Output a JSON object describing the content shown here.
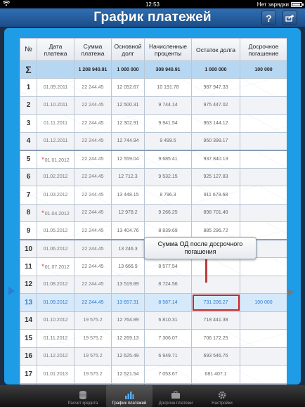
{
  "status": {
    "time": "12:53",
    "charge": "Нет зарядки"
  },
  "nav": {
    "title": "График платежей",
    "help_label": "?",
    "share_icon": "share-icon"
  },
  "table": {
    "headers": [
      "№",
      "Дата\nплатежа",
      "Сумма\nплатежа",
      "Основной\nдолг",
      "Начисленные\nпроценты",
      "Остаток долга",
      "Досрочное\nпогашение"
    ],
    "sum": {
      "symbol": "Σ",
      "payment": "1 208 940.91",
      "principal": "1 000 000",
      "interest": "308 940.91",
      "balance": "1 000 000",
      "early": "100 000"
    },
    "rows": [
      {
        "n": "1",
        "date": "01.09.2011",
        "pay": "22 244.45",
        "od": "12 052.67",
        "pct": "10 191.78",
        "bal": "987 947.33",
        "mark": false
      },
      {
        "n": "2",
        "date": "01.10.2011",
        "pay": "22 244.45",
        "od": "12 500.31",
        "pct": "9 744.14",
        "bal": "975 447.02",
        "mark": false
      },
      {
        "n": "3",
        "date": "01.11.2011",
        "pay": "22 244.45",
        "od": "12 302.91",
        "pct": "9 941.54",
        "bal": "963 144.12",
        "mark": false
      },
      {
        "n": "4",
        "date": "01.12.2011",
        "pay": "22 244.45",
        "od": "12 744.94",
        "pct": "9 499.5",
        "bal": "950 399.17",
        "mark": false
      },
      {
        "n": "5",
        "date": "01.01.2012",
        "pay": "22 244.45",
        "od": "12 559.04",
        "pct": "9 685.41",
        "bal": "937 840.13",
        "mark": true
      },
      {
        "n": "6",
        "date": "01.02.2012",
        "pay": "22 244.45",
        "od": "12 712.3",
        "pct": "9 532.15",
        "bal": "925 127.83",
        "mark": false
      },
      {
        "n": "7",
        "date": "01.03.2012",
        "pay": "22 244.45",
        "od": "13 448.15",
        "pct": "8 796.3",
        "bal": "911 679.68",
        "mark": false
      },
      {
        "n": "8",
        "date": "01.04.2012",
        "pay": "22 244.45",
        "od": "12 978.2",
        "pct": "9 266.25",
        "bal": "898 701.48",
        "mark": true
      },
      {
        "n": "9",
        "date": "01.05.2012",
        "pay": "22 244.45",
        "od": "13 404.76",
        "pct": "8 839.69",
        "bal": "885 296.72",
        "mark": false
      },
      {
        "n": "10",
        "date": "01.06.2012",
        "pay": "22 244.45",
        "od": "13 246.3",
        "pct": "",
        "bal": "",
        "mark": false
      },
      {
        "n": "11",
        "date": "01.07.2012",
        "pay": "22 244.45",
        "od": "13 666.9",
        "pct": "8 577.54",
        "bal": "",
        "mark": true
      },
      {
        "n": "12",
        "date": "01.08.2012",
        "pay": "22 244.45",
        "od": "13 519.89",
        "pct": "8 724.56",
        "bal": "",
        "mark": false
      },
      {
        "n": "13",
        "date": "01.09.2012",
        "pay": "22 244.45",
        "od": "13 657.31",
        "pct": "8 587.14",
        "bal": "731 206.27",
        "early": "100 000",
        "mark": false,
        "highlight": true
      },
      {
        "n": "14",
        "date": "01.10.2012",
        "pay": "19 575.2",
        "od": "12 764.89",
        "pct": "6 810.31",
        "bal": "718 441.38",
        "mark": false
      },
      {
        "n": "15",
        "date": "01.11.2012",
        "pay": "19 575.2",
        "od": "12 269.13",
        "pct": "7 306.07",
        "bal": "706 172.25",
        "mark": false
      },
      {
        "n": "16",
        "date": "01.12.2012",
        "pay": "19 575.2",
        "od": "12 625.49",
        "pct": "6 949.71",
        "bal": "693 546.76",
        "mark": false
      },
      {
        "n": "17",
        "date": "01.01.2013",
        "pay": "19 575.2",
        "od": "12 521.54",
        "pct": "7 053.67",
        "bal": "681 407.1",
        "mark": false
      },
      {
        "n": "18",
        "date": "01.02.2013",
        "pay": "19 575.2",
        "od": "12 561.58",
        "pct": "6 945.62",
        "bal": "",
        "mark": false
      }
    ]
  },
  "callout": {
    "text_line1": "Сумма ОД после досрочного",
    "text_line2": "погашения"
  },
  "tabs": [
    {
      "label": "Расчет кредита",
      "icon": "coins-icon",
      "active": false
    },
    {
      "label": "График платежей",
      "icon": "bar-chart-icon",
      "active": true
    },
    {
      "label": "Досрочн.платежи",
      "icon": "briefcase-icon",
      "active": false
    },
    {
      "label": "Настройки",
      "icon": "gear-icon",
      "active": false
    }
  ]
}
